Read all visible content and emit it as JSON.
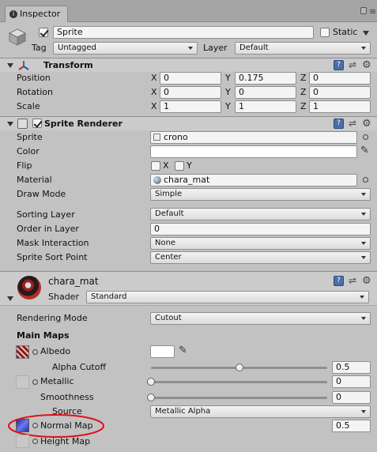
{
  "window": {
    "tab_label": "Inspector"
  },
  "object": {
    "name": "Sprite",
    "static_label": "Static",
    "tag_label": "Tag",
    "tag_value": "Untagged",
    "layer_label": "Layer",
    "layer_value": "Default"
  },
  "transform": {
    "title": "Transform",
    "rows": [
      {
        "label": "Position",
        "x": "0",
        "y": "0.175",
        "z": "0"
      },
      {
        "label": "Rotation",
        "x": "0",
        "y": "0",
        "z": "0"
      },
      {
        "label": "Scale",
        "x": "1",
        "y": "1",
        "z": "1"
      }
    ],
    "axis_x": "X",
    "axis_y": "Y",
    "axis_z": "Z"
  },
  "sprite_renderer": {
    "title": "Sprite Renderer",
    "sprite_label": "Sprite",
    "sprite_value": "crono",
    "color_label": "Color",
    "color_value": "#ffffff",
    "flip_label": "Flip",
    "flip_x": "X",
    "flip_y": "Y",
    "material_label": "Material",
    "material_value": "chara_mat",
    "draw_mode_label": "Draw Mode",
    "draw_mode_value": "Simple",
    "sorting_layer_label": "Sorting Layer",
    "sorting_layer_value": "Default",
    "order_label": "Order in Layer",
    "order_value": "0",
    "mask_label": "Mask Interaction",
    "mask_value": "None",
    "sort_point_label": "Sprite Sort Point",
    "sort_point_value": "Center"
  },
  "material": {
    "name": "chara_mat",
    "shader_label": "Shader",
    "shader_value": "Standard",
    "rendering_mode_label": "Rendering Mode",
    "rendering_mode_value": "Cutout",
    "main_maps_label": "Main Maps",
    "albedo_label": "Albedo",
    "alpha_cutoff_label": "Alpha Cutoff",
    "alpha_cutoff_value": "0.5",
    "alpha_cutoff_fraction": 0.5,
    "metallic_label": "Metallic",
    "metallic_value": "0",
    "metallic_fraction": 0,
    "smoothness_label": "Smoothness",
    "smoothness_value": "0",
    "smoothness_fraction": 0,
    "source_label": "Source",
    "source_value": "Metallic Alpha",
    "normal_map_label": "Normal Map",
    "normal_map_value": "0.5",
    "height_map_label": "Height Map"
  },
  "colors": {
    "annotation": "#e0101a",
    "book_icon": "#4a6fa8"
  }
}
